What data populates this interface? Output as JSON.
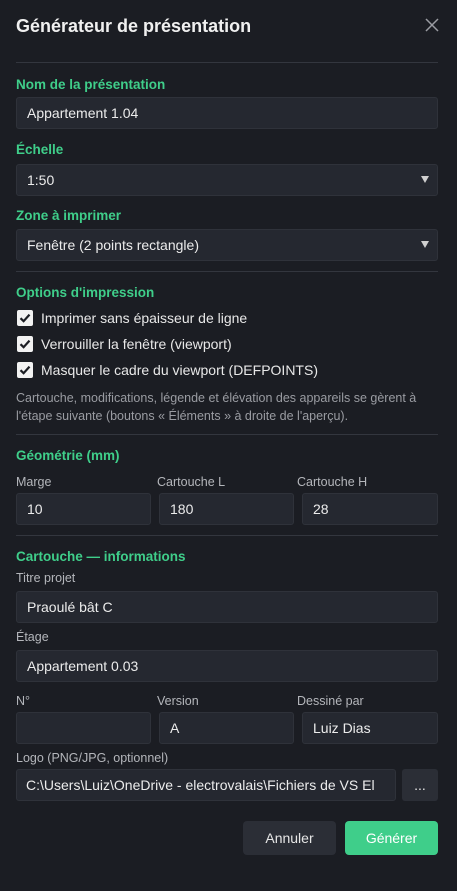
{
  "dialog": {
    "title": "Générateur de présentation",
    "close_icon": "close-icon"
  },
  "presentation": {
    "name_label": "Nom de la présentation",
    "name_value": "Appartement 1.04"
  },
  "scale": {
    "label": "Échelle",
    "value": "1:50"
  },
  "print_zone": {
    "label": "Zone à imprimer",
    "value": "Fenêtre (2 points rectangle)"
  },
  "print_options": {
    "label": "Options d'impression",
    "items": [
      {
        "label": "Imprimer sans épaisseur de ligne",
        "checked": true
      },
      {
        "label": "Verrouiller la fenêtre (viewport)",
        "checked": true
      },
      {
        "label": "Masquer le cadre du viewport (DEFPOINTS)",
        "checked": true
      }
    ],
    "help": "Cartouche, modifications, légende et élévation des appareils se gèrent à l'étape suivante (boutons « Éléments » à droite de l'aperçu)."
  },
  "geometry": {
    "label": "Géométrie (mm)",
    "margin_label": "Marge",
    "margin_value": "10",
    "width_label": "Cartouche L",
    "width_value": "180",
    "height_label": "Cartouche H",
    "height_value": "28"
  },
  "titleblock": {
    "label": "Cartouche — informations",
    "project_label": "Titre projet",
    "project_value": "Praoulé bât C",
    "floor_label": "Étage",
    "floor_value": "Appartement 0.03",
    "number_label": "N°",
    "number_value": "",
    "version_label": "Version",
    "version_value": "A",
    "drawn_label": "Dessiné par",
    "drawn_value": "Luiz Dias",
    "logo_label": "Logo (PNG/JPG, optionnel)",
    "logo_value": "C:\\Users\\Luiz\\OneDrive - electrovalais\\Fichiers de VS El",
    "browse_label": "..."
  },
  "actions": {
    "cancel_label": "Annuler",
    "generate_label": "Générer"
  },
  "colors": {
    "accent": "#3fce8a",
    "background": "#1b1d23",
    "input": "#252830"
  }
}
